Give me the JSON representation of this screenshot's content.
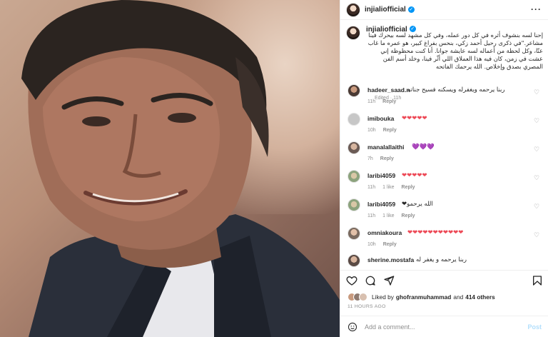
{
  "post": {
    "username": "injialiofficial",
    "caption": "إحنا لسه بنشوف أثره في كل دور عمله، وفي كل مشهد لسه بيحرك فينا مشاعر.\"في ذكرى رحيل أحمد زكي، بنحس بفراغ كبير، هو عمره ما غاب عنّا، وكل لحظة من أعماله لسه عايشة جوانا. أنا كنت محظوظة إني عشت في زمن، كان فيه هذا العملاق اللي أثّر فينا، وخلد أسم الفن المصري بصدق وإخلاص. الله يرحمك الفاتحه",
    "edited": "Edited",
    "caption_time": "11h"
  },
  "comments": [
    {
      "user": "hadeer_saad.n",
      "text": "ربنا يرحمه ويغفرله ويسكنه فسيح جناته",
      "time": "11h",
      "likes": "",
      "reply": "Reply"
    },
    {
      "user": "imibouka",
      "text": "❤❤❤❤❤",
      "time": "10h",
      "likes": "",
      "reply": "Reply"
    },
    {
      "user": "manalallaithi",
      "text": "💜💜💜",
      "time": "7h",
      "likes": "",
      "reply": "Reply"
    },
    {
      "user": "laribi4059",
      "text": "❤❤❤❤❤",
      "time": "11h",
      "likes": "1 like",
      "reply": "Reply"
    },
    {
      "user": "laribi4059",
      "text": "الله يرحمو❤",
      "time": "11h",
      "likes": "1 like",
      "reply": "Reply"
    },
    {
      "user": "omniakoura",
      "text": "❤❤❤❤❤❤❤❤❤❤❤",
      "time": "10h",
      "likes": "",
      "reply": "Reply"
    },
    {
      "user": "sherine.mostafa",
      "text": "ربنا يرحمه و يغفر له",
      "time": "",
      "likes": "",
      "reply": ""
    }
  ],
  "likes": {
    "prefix": "Liked by",
    "first_user": "ghofranmuhammad",
    "connector": "and",
    "others": "414 others"
  },
  "time_ago": "11 HOURS AGO",
  "add_comment": {
    "placeholder": "Add a comment...",
    "post_label": "Post"
  },
  "colors": {
    "accent": "#0095f6",
    "heart": "#ed4956",
    "muted": "#8e8e8e",
    "post_disabled": "#b2dffc"
  }
}
